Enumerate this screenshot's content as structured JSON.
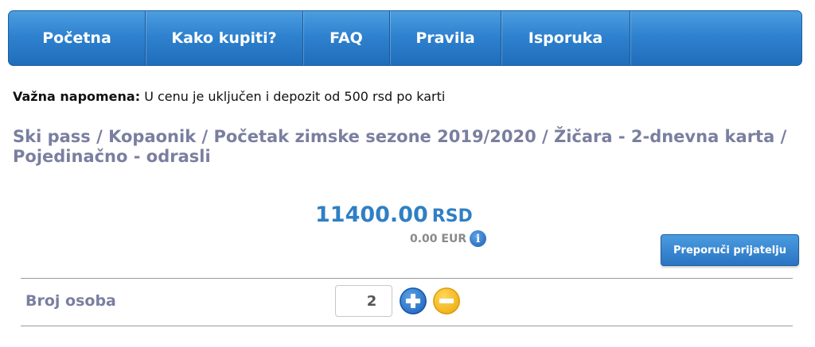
{
  "nav": {
    "items": [
      {
        "label": "Početna"
      },
      {
        "label": "Kako kupiti?"
      },
      {
        "label": "FAQ"
      },
      {
        "label": "Pravila"
      },
      {
        "label": "Isporuka"
      }
    ]
  },
  "note": {
    "label": "Važna napomena:",
    "text": " U cenu je uključen i depozit od 500 rsd po karti"
  },
  "breadcrumb": "Ski pass / Kopaonik / Početak zimske sezone 2019/2020 / Žičara - 2-dnevna karta / Pojedinačno - odrasli",
  "price": {
    "amount": "11400.00",
    "currency": "RSD",
    "eur": "0.00 EUR"
  },
  "recommend_label": "Preporuči prijatelju",
  "persons": {
    "label": "Broj osoba",
    "value": "2"
  },
  "colors": {
    "nav": "#2f82cf",
    "accent": "#2f7fc4",
    "muted": "#7a7fa0",
    "minus": "#f0b400"
  },
  "icons": [
    "info-icon",
    "plus-icon",
    "minus-icon"
  ]
}
